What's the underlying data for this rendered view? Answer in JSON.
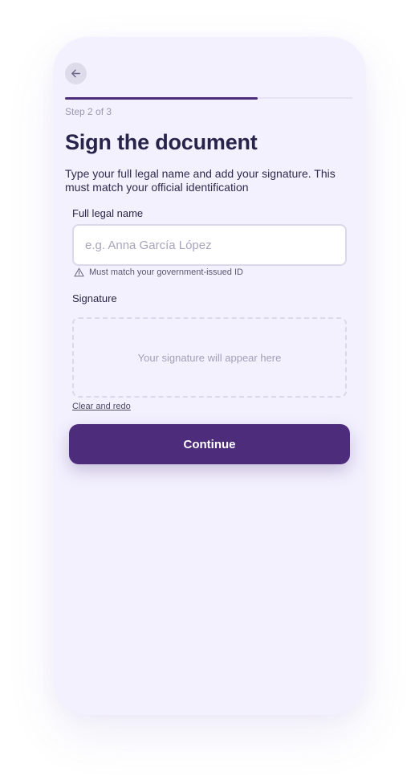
{
  "header": {
    "back_icon": "arrow-left-icon",
    "step_label": "Step 2 of 3",
    "progress_fraction": 0.67
  },
  "main": {
    "title": "Sign the document",
    "description": "Type your full legal name and add your signature. This must match your official identification"
  },
  "name_field": {
    "label": "Full legal name",
    "value": "",
    "placeholder": "e.g. Anna García López",
    "hint": "Must match your government-issued ID",
    "hint_icon": "warning-icon"
  },
  "signature_field": {
    "label": "Signature",
    "placeholder": "Your signature will appear here",
    "clear_label": "Clear and redo"
  },
  "actions": {
    "continue_label": "Continue"
  },
  "colors": {
    "accent": "#4e2c7c",
    "background": "#f3f1fe",
    "title": "#27234a"
  }
}
